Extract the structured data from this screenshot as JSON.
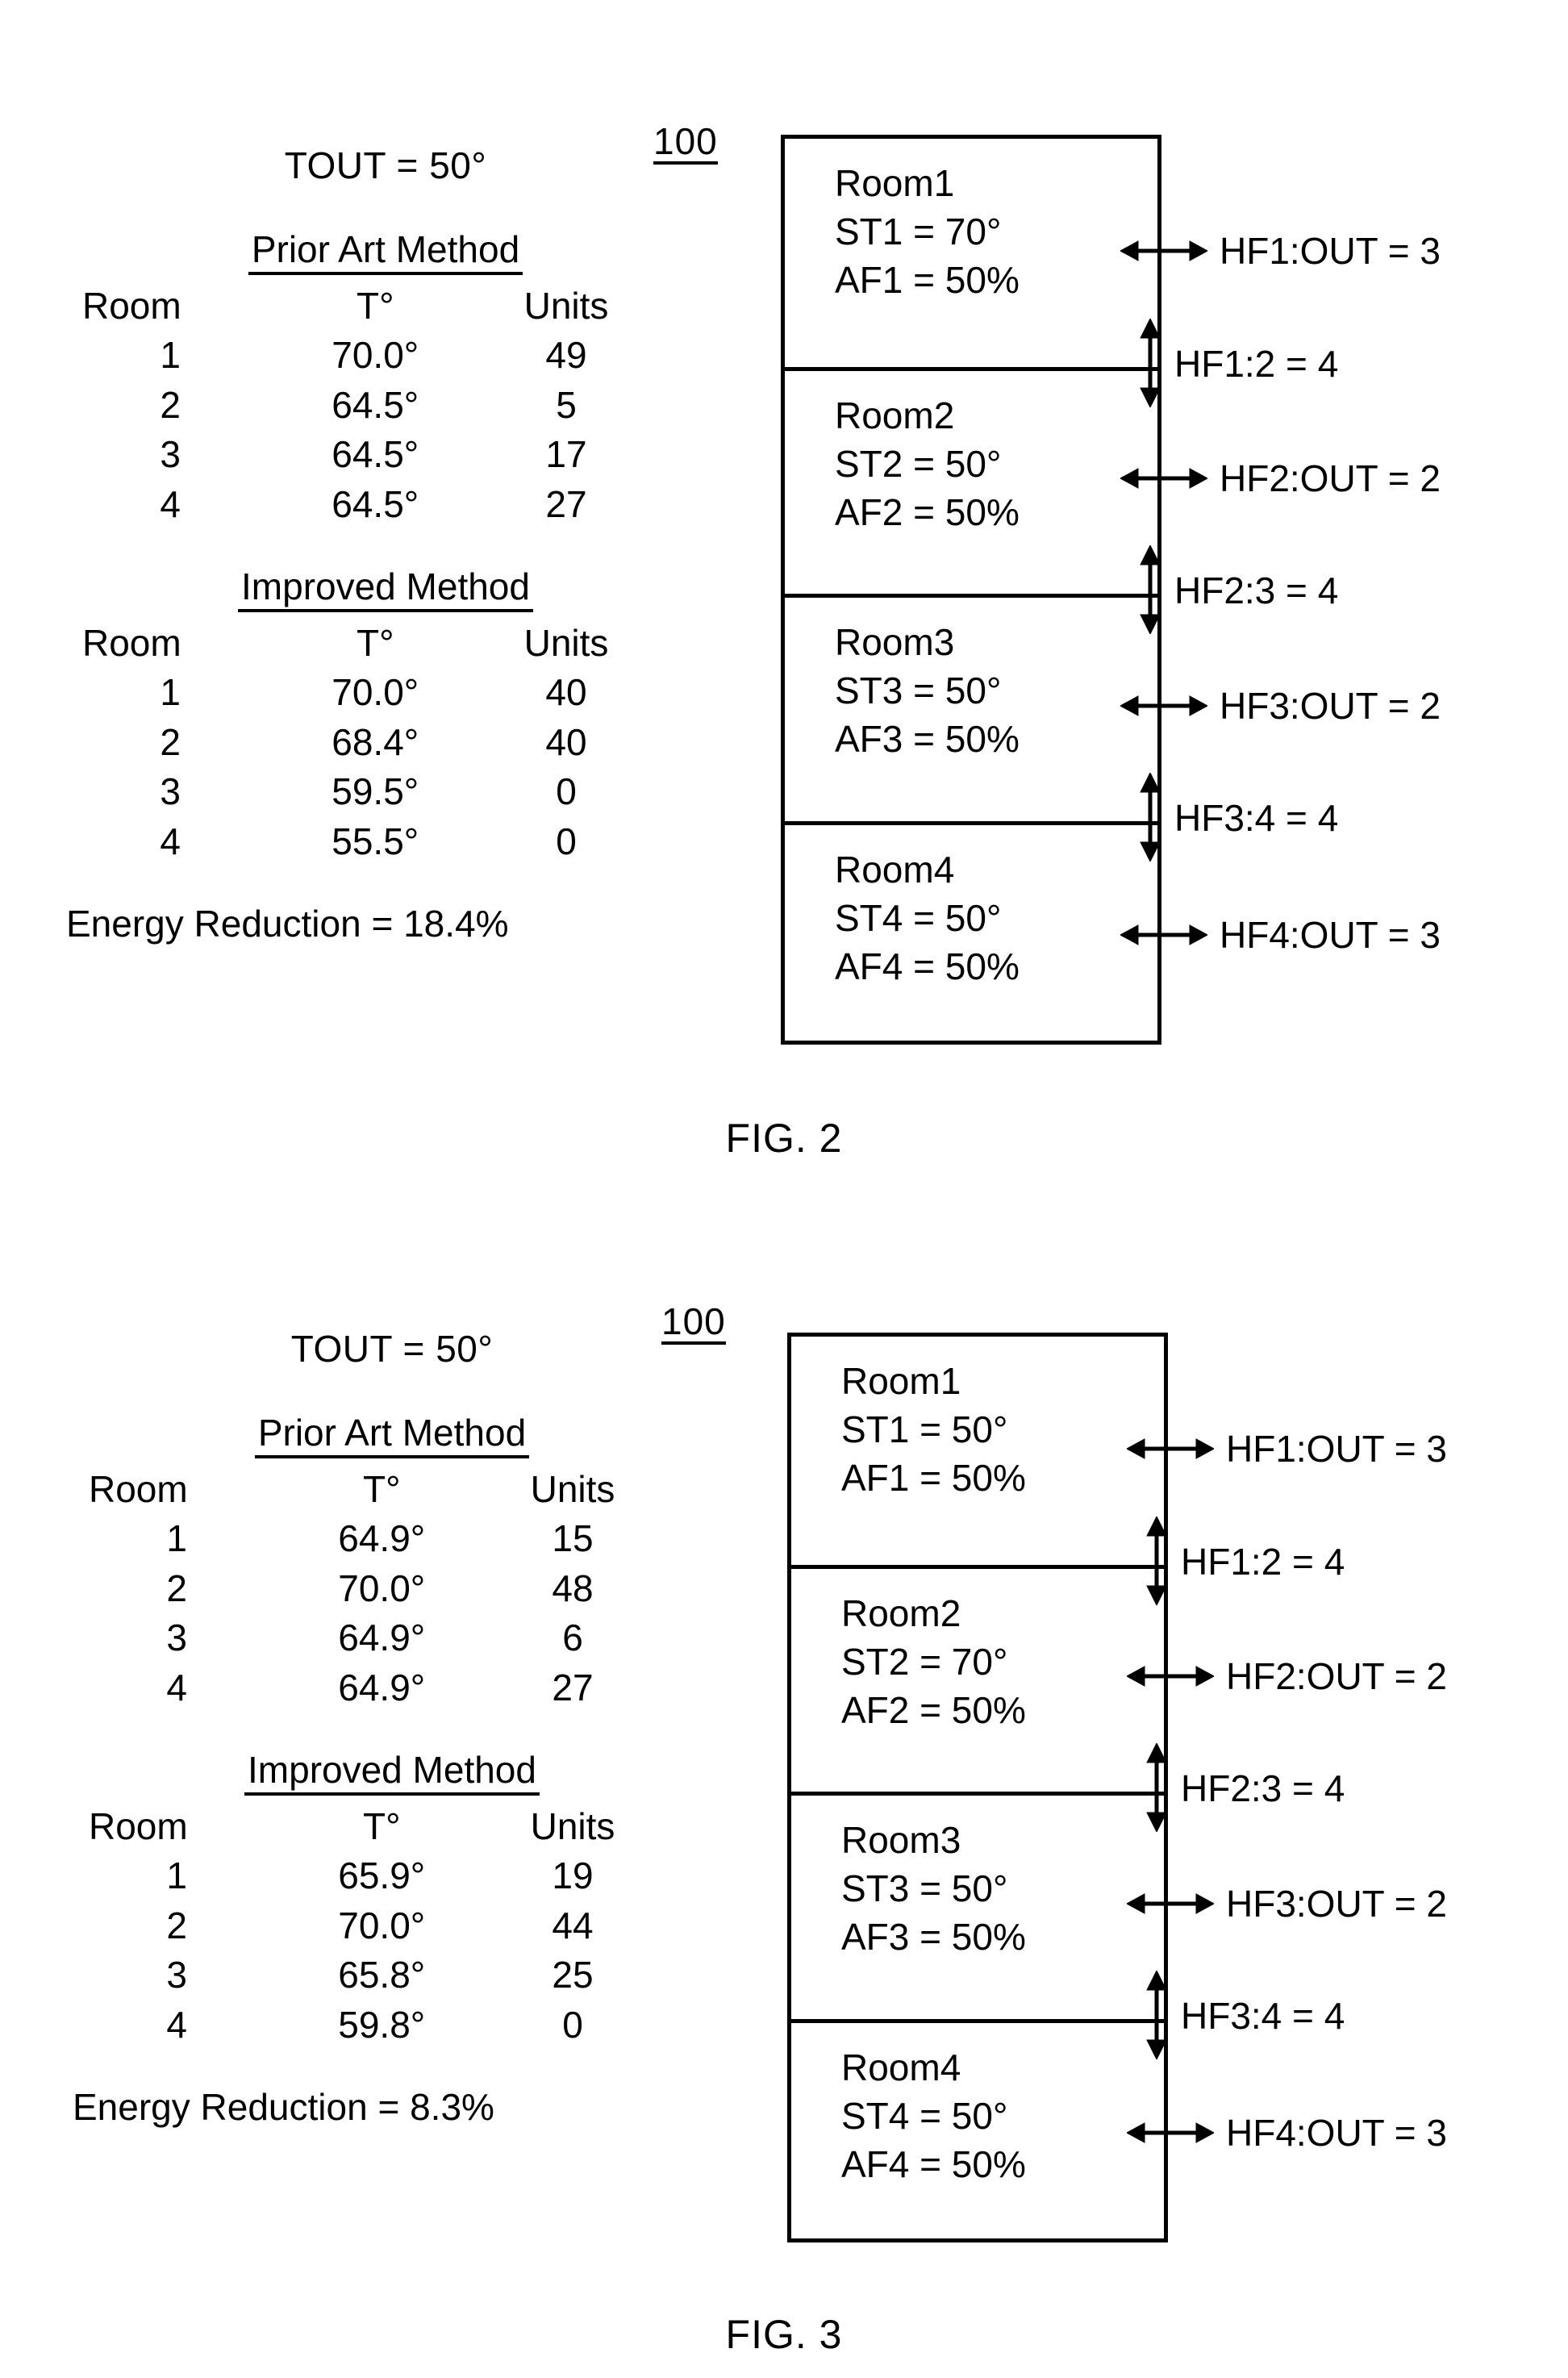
{
  "page": {
    "background_color": "#ffffff",
    "ink_color": "#000000"
  },
  "figures": [
    {
      "caption": "FIG. 2",
      "reference_numeral": "100",
      "tout_label": "TOUT = 50°",
      "tables": [
        {
          "title": "Prior Art Method",
          "headers": [
            "Room",
            "T°",
            "Units"
          ],
          "rows": [
            [
              "1",
              "70.0°",
              "49"
            ],
            [
              "2",
              "64.5°",
              "5"
            ],
            [
              "3",
              "64.5°",
              "17"
            ],
            [
              "4",
              "64.5°",
              "27"
            ]
          ]
        },
        {
          "title": "Improved Method",
          "headers": [
            "Room",
            "T°",
            "Units"
          ],
          "rows": [
            [
              "1",
              "70.0°",
              "40"
            ],
            [
              "2",
              "68.4°",
              "40"
            ],
            [
              "3",
              "59.5°",
              "0"
            ],
            [
              "4",
              "55.5°",
              "0"
            ]
          ]
        }
      ],
      "energy_reduction": "Energy Reduction = 18.4%",
      "rooms": [
        {
          "name": "Room1",
          "setpoint": "ST1 = 70°",
          "airflow": "AF1 = 50%",
          "out_flow": "HF1:OUT = 3"
        },
        {
          "name": "Room2",
          "setpoint": "ST2 = 50°",
          "airflow": "AF2 = 50%",
          "out_flow": "HF2:OUT = 2"
        },
        {
          "name": "Room3",
          "setpoint": "ST3 = 50°",
          "airflow": "AF3 = 50%",
          "out_flow": "HF3:OUT = 2"
        },
        {
          "name": "Room4",
          "setpoint": "ST4 = 50°",
          "airflow": "AF4 = 50%",
          "out_flow": "HF4:OUT = 3"
        }
      ],
      "inter_room_flows": [
        "HF1:2 = 4",
        "HF2:3 = 4",
        "HF3:4 = 4"
      ]
    },
    {
      "caption": "FIG. 3",
      "reference_numeral": "100",
      "tout_label": "TOUT = 50°",
      "tables": [
        {
          "title": "Prior Art Method",
          "headers": [
            "Room",
            "T°",
            "Units"
          ],
          "rows": [
            [
              "1",
              "64.9°",
              "15"
            ],
            [
              "2",
              "70.0°",
              "48"
            ],
            [
              "3",
              "64.9°",
              "6"
            ],
            [
              "4",
              "64.9°",
              "27"
            ]
          ]
        },
        {
          "title": "Improved Method",
          "headers": [
            "Room",
            "T°",
            "Units"
          ],
          "rows": [
            [
              "1",
              "65.9°",
              "19"
            ],
            [
              "2",
              "70.0°",
              "44"
            ],
            [
              "3",
              "65.8°",
              "25"
            ],
            [
              "4",
              "59.8°",
              "0"
            ]
          ]
        }
      ],
      "energy_reduction": "Energy Reduction = 8.3%",
      "rooms": [
        {
          "name": "Room1",
          "setpoint": "ST1 = 50°",
          "airflow": "AF1 = 50%",
          "out_flow": "HF1:OUT = 3"
        },
        {
          "name": "Room2",
          "setpoint": "ST2 = 70°",
          "airflow": "AF2 = 50%",
          "out_flow": "HF2:OUT = 2"
        },
        {
          "name": "Room3",
          "setpoint": "ST3 = 50°",
          "airflow": "AF3 = 50%",
          "out_flow": "HF3:OUT = 2"
        },
        {
          "name": "Room4",
          "setpoint": "ST4 = 50°",
          "airflow": "AF4 = 50%",
          "out_flow": "HF4:OUT = 3"
        }
      ],
      "inter_room_flows": [
        "HF1:2 = 4",
        "HF2:3 = 4",
        "HF3:4 = 4"
      ]
    }
  ]
}
